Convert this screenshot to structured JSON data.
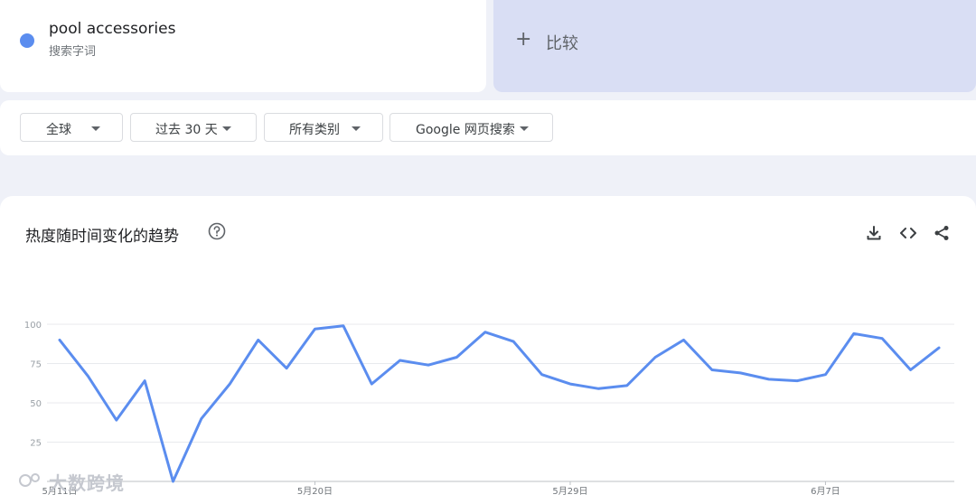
{
  "term": {
    "name": "pool accessories",
    "type": "搜索字词",
    "color": "#5b8def"
  },
  "compare": {
    "label": "比较",
    "icon": "plus-icon"
  },
  "filters": [
    {
      "label": "全球",
      "icon": "caret-down-icon"
    },
    {
      "label": "过去 30 天",
      "icon": "caret-down-icon"
    },
    {
      "label": "所有类别",
      "icon": "caret-down-icon"
    },
    {
      "label": "Google 网页搜索",
      "icon": "caret-down-icon"
    }
  ],
  "chart_title": "热度随时间变化的趋势",
  "toolbar_icons": [
    "help-icon",
    "download-icon",
    "embed-code-icon",
    "share-icon"
  ],
  "watermark": "大数跨境",
  "chart_data": {
    "type": "line",
    "title": "热度随时间变化的趋势",
    "xlabel": "",
    "ylabel": "",
    "ylim": [
      0,
      100
    ],
    "yticks": [
      25,
      50,
      75,
      100
    ],
    "x_tick_labels": [
      "5月11日",
      "5月20日",
      "5月29日",
      "6月7日"
    ],
    "x_tick_indices": [
      0,
      9,
      18,
      27
    ],
    "grid": true,
    "series": [
      {
        "name": "pool accessories",
        "color": "#5b8def",
        "values": [
          90,
          67,
          39,
          64,
          0,
          40,
          62,
          90,
          72,
          97,
          99,
          62,
          77,
          74,
          79,
          95,
          89,
          68,
          62,
          59,
          61,
          79,
          90,
          71,
          69,
          65,
          64,
          68,
          94,
          91,
          71,
          85
        ]
      }
    ]
  }
}
